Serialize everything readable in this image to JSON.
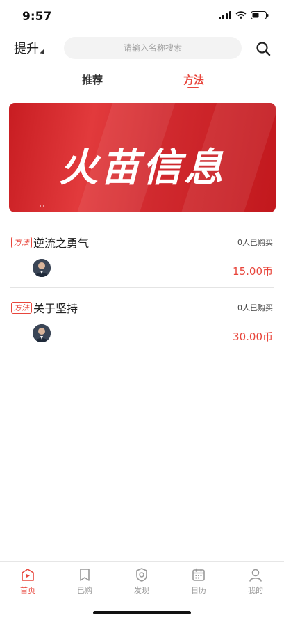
{
  "status_bar": {
    "time": "9:57"
  },
  "header": {
    "category_label": "提升",
    "search_placeholder": "请输入名称搜索"
  },
  "tabs": [
    {
      "label": "推荐",
      "active": false
    },
    {
      "label": "方法",
      "active": true
    }
  ],
  "banner": {
    "title": "火苗信息"
  },
  "courses": [
    {
      "tag": "方法",
      "title": "逆流之勇气",
      "buyers": "0人已购买",
      "price": "15.00币"
    },
    {
      "tag": "方法",
      "title": "关于坚持",
      "buyers": "0人已购买",
      "price": "30.00币"
    }
  ],
  "tabbar": {
    "items": [
      {
        "label": "首页",
        "icon": "home-icon",
        "active": true
      },
      {
        "label": "已购",
        "icon": "bookmark-icon",
        "active": false
      },
      {
        "label": "发现",
        "icon": "discover-icon",
        "active": false
      },
      {
        "label": "日历",
        "icon": "calendar-icon",
        "active": false
      },
      {
        "label": "我的",
        "icon": "profile-icon",
        "active": false
      }
    ]
  },
  "colors": {
    "accent": "#e8463c",
    "banner": "#d12a2f"
  }
}
